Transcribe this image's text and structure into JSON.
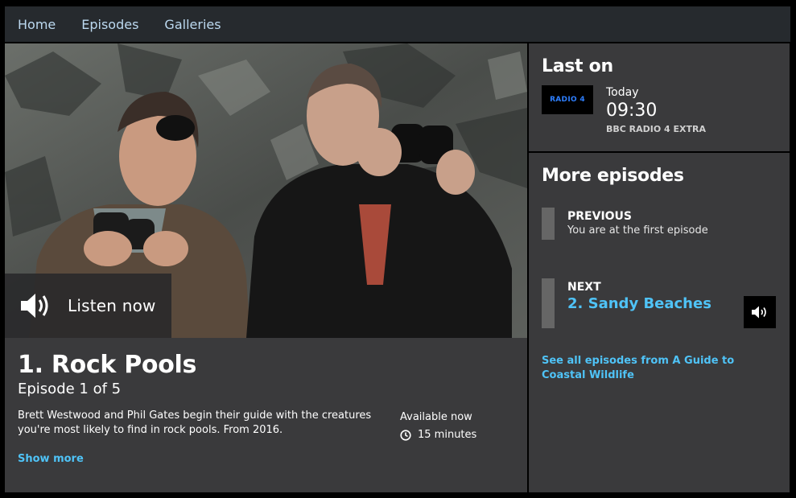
{
  "nav": {
    "items": [
      "Home",
      "Episodes",
      "Galleries"
    ]
  },
  "hero": {
    "listen_label": "Listen now",
    "speaker_icon": "speaker-icon"
  },
  "episode": {
    "title": "1. Rock Pools",
    "subtitle": "Episode 1 of 5",
    "description": "Brett Westwood and Phil Gates begin their guide with the creatures you're most likely to find in rock pools. From 2016.",
    "availability": "Available now",
    "duration": "15 minutes",
    "show_more": "Show more"
  },
  "last_on": {
    "title": "Last on",
    "logo_text": "RADIO 4",
    "day": "Today",
    "time": "09:30",
    "station": "BBC RADIO 4 EXTRA"
  },
  "more_episodes": {
    "title": "More episodes",
    "previous_label": "PREVIOUS",
    "previous_note": "You are at the first episode",
    "next_label": "NEXT",
    "next_title": "2. Sandy Beaches",
    "see_all": "See all episodes from A Guide to Coastal Wildlife"
  },
  "colors": {
    "accent": "#4fc3f7",
    "panel": "#3a3a3c",
    "nav": "#262a2e"
  }
}
